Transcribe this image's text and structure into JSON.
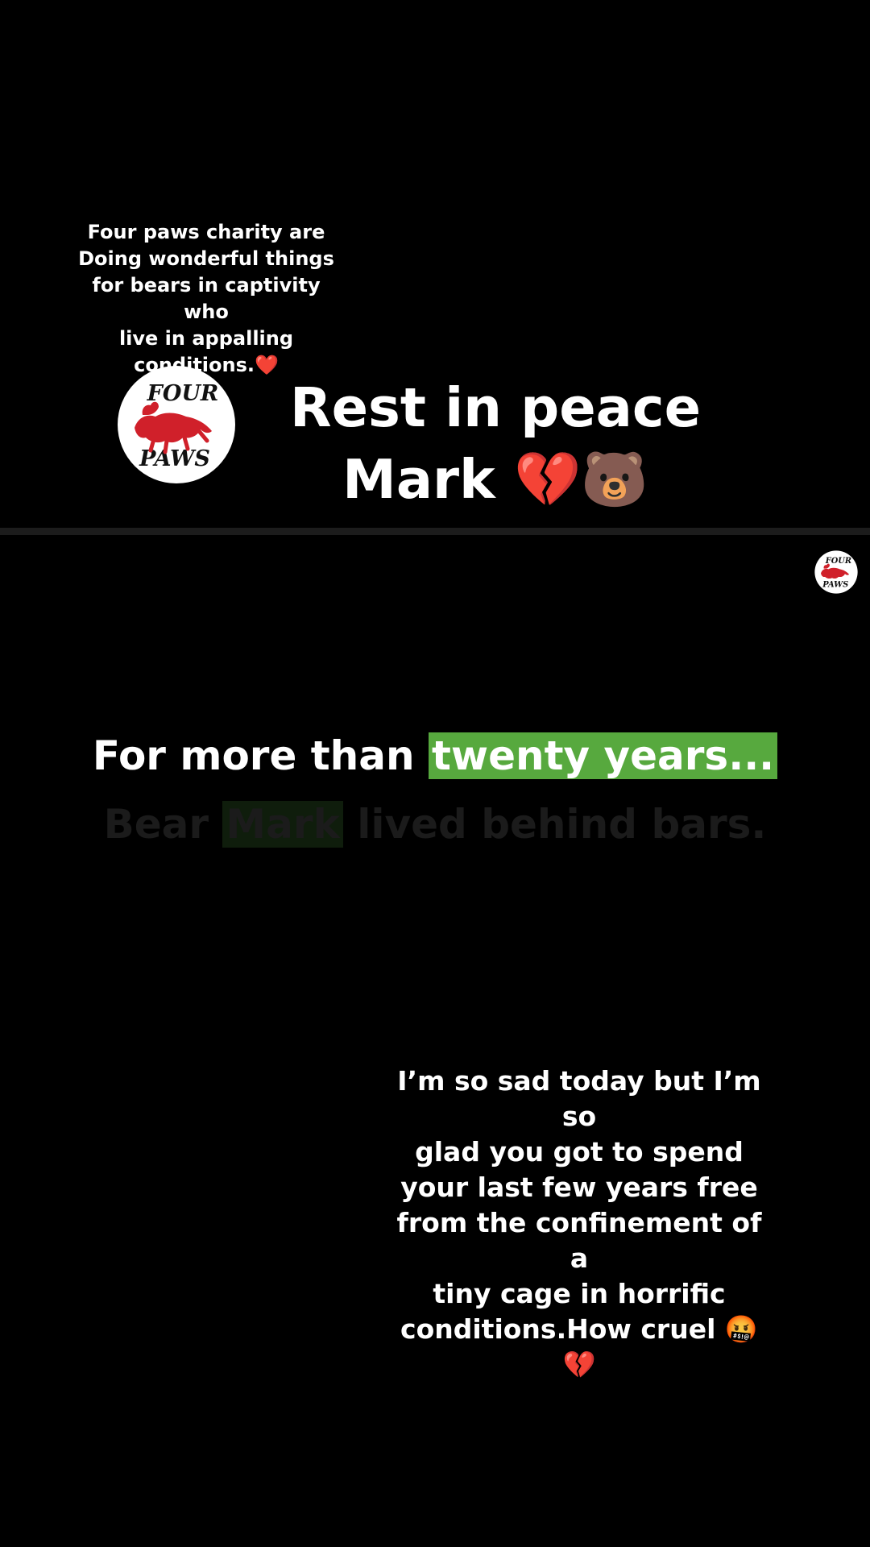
{
  "top_panel": {
    "caption": "Four paws charity are\nDoing wonderful things\nfor bears in captivity who\nlive in appalling\nconditions.❤️",
    "title": "Rest in peace\nMark 💔🐻"
  },
  "logo": {
    "text_top": "FOUR",
    "text_bottom": "PAWS",
    "color": "#d0202a"
  },
  "bottom_panel": {
    "subtitle_active_plain": "For more than ",
    "subtitle_active_highlight": "twenty years...",
    "subtitle_next_1": "Bear ",
    "subtitle_next_highlight": "Mark",
    "subtitle_next_2": " lived behind bars.",
    "highlight_color": "#57a93e",
    "caption": "I’m so sad today but I’m so\nglad you got to spend\nyour last few years free\nfrom the confinement of a\ntiny cage in horrific\nconditions.How cruel 🤬💔"
  }
}
